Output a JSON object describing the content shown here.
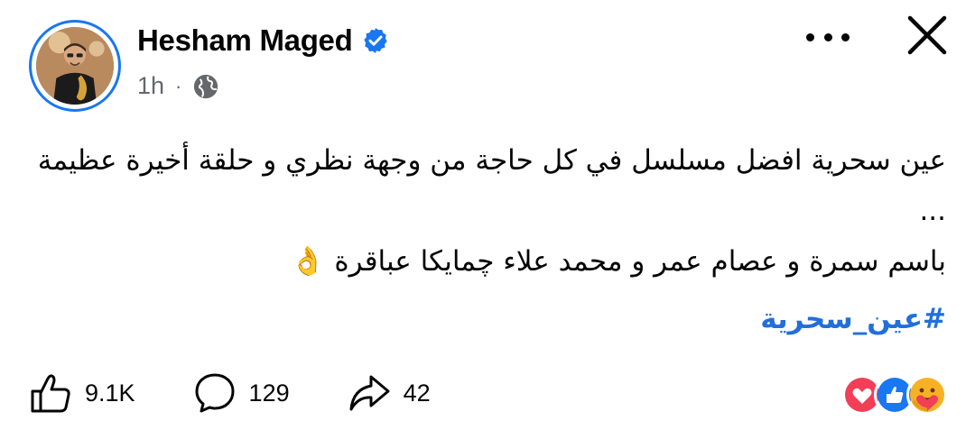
{
  "author": {
    "name": "Hesham Maged",
    "verified": true
  },
  "meta": {
    "time": "1h",
    "separator": "·",
    "audience_icon": "globe-icon"
  },
  "post": {
    "line1": "عين سحرية افضل مسلسل في كل حاجة من وجهة نظري و حلقة أخيرة عظيمة",
    "line2": "...",
    "line3": "باسم سمرة و عصام عمر و محمد علاء چمايكا عباقرة 👌",
    "hashtag": "#عين_سحرية"
  },
  "actions": {
    "likes": "9.1K",
    "comments": "129",
    "shares": "42"
  },
  "reactions": [
    "like-icon",
    "love-icon",
    "care-icon"
  ],
  "colors": {
    "accent": "#1877f2",
    "hashtag": "#216fdb",
    "love": "#f33e58",
    "secondary_text": "#65676b"
  }
}
